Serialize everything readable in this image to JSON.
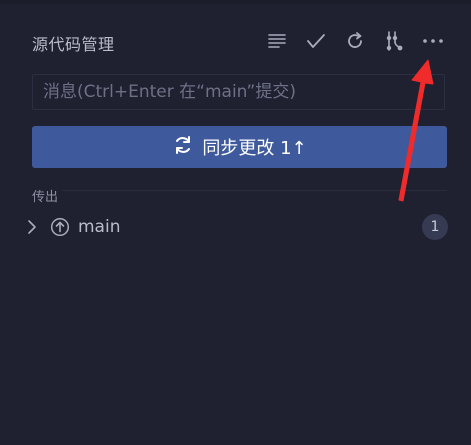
{
  "panel": {
    "title": "源代码管理",
    "actions": [
      {
        "name": "view-as-tree-icon"
      },
      {
        "name": "commit-check-icon"
      },
      {
        "name": "refresh-icon"
      },
      {
        "name": "branch-graph-icon"
      },
      {
        "name": "more-actions-icon"
      }
    ]
  },
  "commit": {
    "placeholder": "消息(Ctrl+Enter 在“main”提交)"
  },
  "sync": {
    "label": "同步更改 1↑",
    "icon": "sync-icon"
  },
  "outgoing": {
    "section_label": "传出",
    "branch": "main",
    "count": "1"
  },
  "annotation": {
    "arrow_color": "#ef2b2b"
  }
}
